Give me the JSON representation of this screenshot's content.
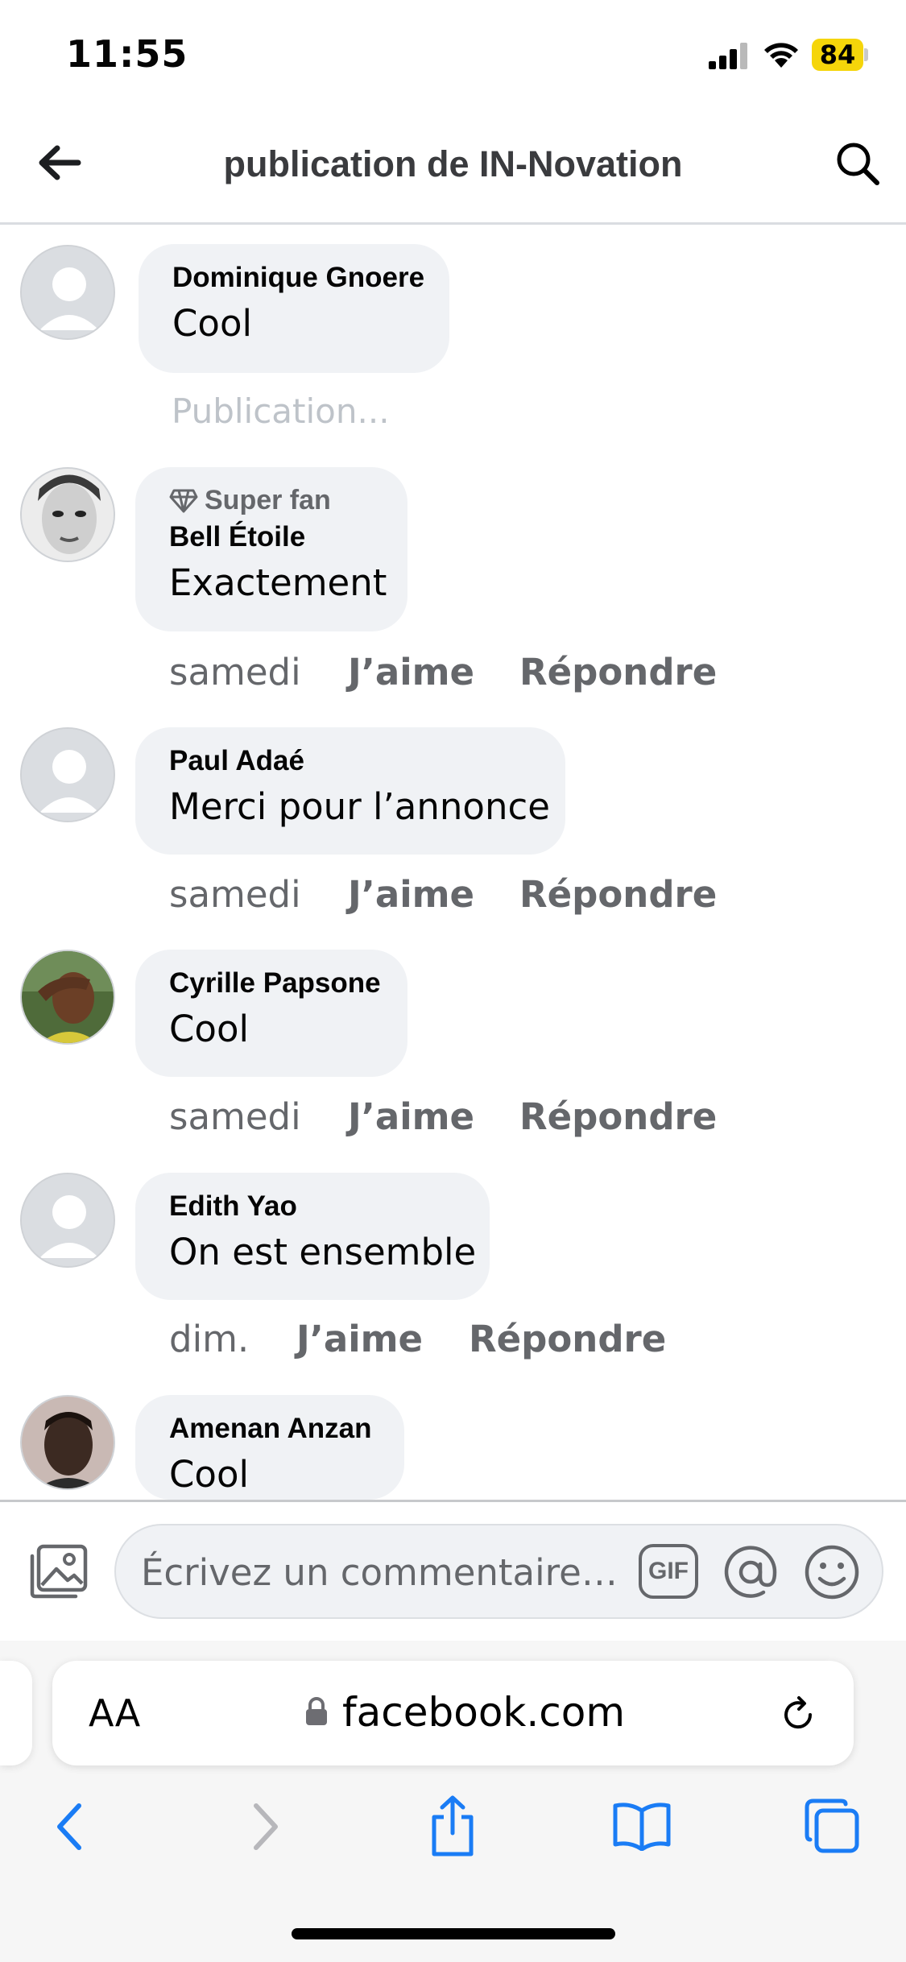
{
  "status_bar": {
    "time": "11:55",
    "battery": "84"
  },
  "header": {
    "title": "publication de IN-Novation"
  },
  "comments": [
    {
      "author": "Dominique Gnoere",
      "text": "Cool",
      "pending": "Publication..."
    },
    {
      "badge": "Super fan",
      "author": "Bell Étoile",
      "text": "Exactement",
      "time": "samedi",
      "like": "J’aime",
      "reply": "Répondre"
    },
    {
      "author": "Paul Adaé",
      "text": "Merci pour l’annonce",
      "time": "samedi",
      "like": "J’aime",
      "reply": "Répondre"
    },
    {
      "author": "Cyrille Papsone",
      "text": "Cool",
      "time": "samedi",
      "like": "J’aime",
      "reply": "Répondre"
    },
    {
      "author": "Edith Yao",
      "text": "On est ensemble",
      "time": "dim.",
      "like": "J’aime",
      "reply": "Répondre"
    },
    {
      "author": "Amenan Anzan",
      "text": "Cool"
    }
  ],
  "composer": {
    "placeholder": "Écrivez un commentaire…",
    "gif_label": "GIF"
  },
  "browser": {
    "text_size_label": "AA",
    "domain": "facebook.com"
  },
  "colors": {
    "text_secondary": "#65676b",
    "bubble": "#f0f2f5",
    "ios_blue": "#1a7cf5",
    "battery": "#f5d50a"
  }
}
